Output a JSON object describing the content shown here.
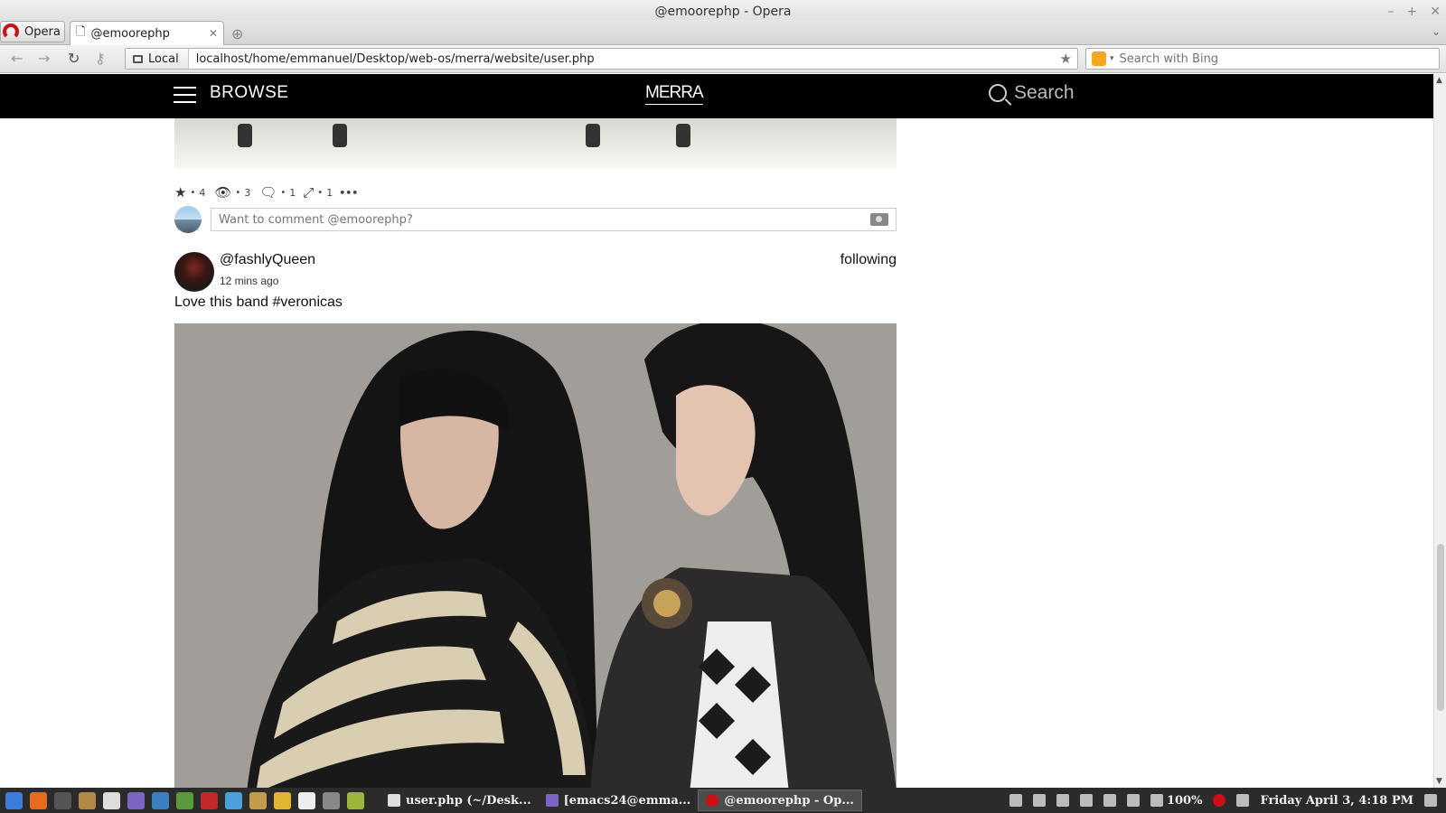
{
  "window": {
    "title": "@emoorephp - Opera"
  },
  "tabs": {
    "opera_menu": "Opera",
    "active_tab": "@emoorephp"
  },
  "addressbar": {
    "security_label": "Local",
    "url": "localhost/home/emmanuel/Desktop/web-os/merra/website/user.php",
    "search_placeholder": "Search with Bing"
  },
  "site": {
    "browse_label": "BROWSE",
    "logo": "MERRA",
    "search_label": "Search"
  },
  "previous_post": {
    "stats": {
      "stars": "4",
      "views": "3",
      "comments": "1",
      "shares": "1",
      "more": "•••"
    },
    "comment_placeholder": "Want to comment @emoorephp?"
  },
  "post": {
    "username": "@fashlyQueen",
    "time": "12 mins ago",
    "follow_status": "following",
    "caption": "Love this band #veronicas"
  },
  "taskbar": {
    "tasks": [
      {
        "label": "user.php (~/Desk..."
      },
      {
        "label": "[emacs24@emma..."
      },
      {
        "label": "@emoorephp - Op..."
      }
    ],
    "battery": "100%",
    "clock": "Friday April  3,  4:18 PM"
  },
  "colors": {
    "header_bg": "#000000",
    "taskbar_bg": "#2b2b2b",
    "opera_red": "#cc0f16"
  }
}
